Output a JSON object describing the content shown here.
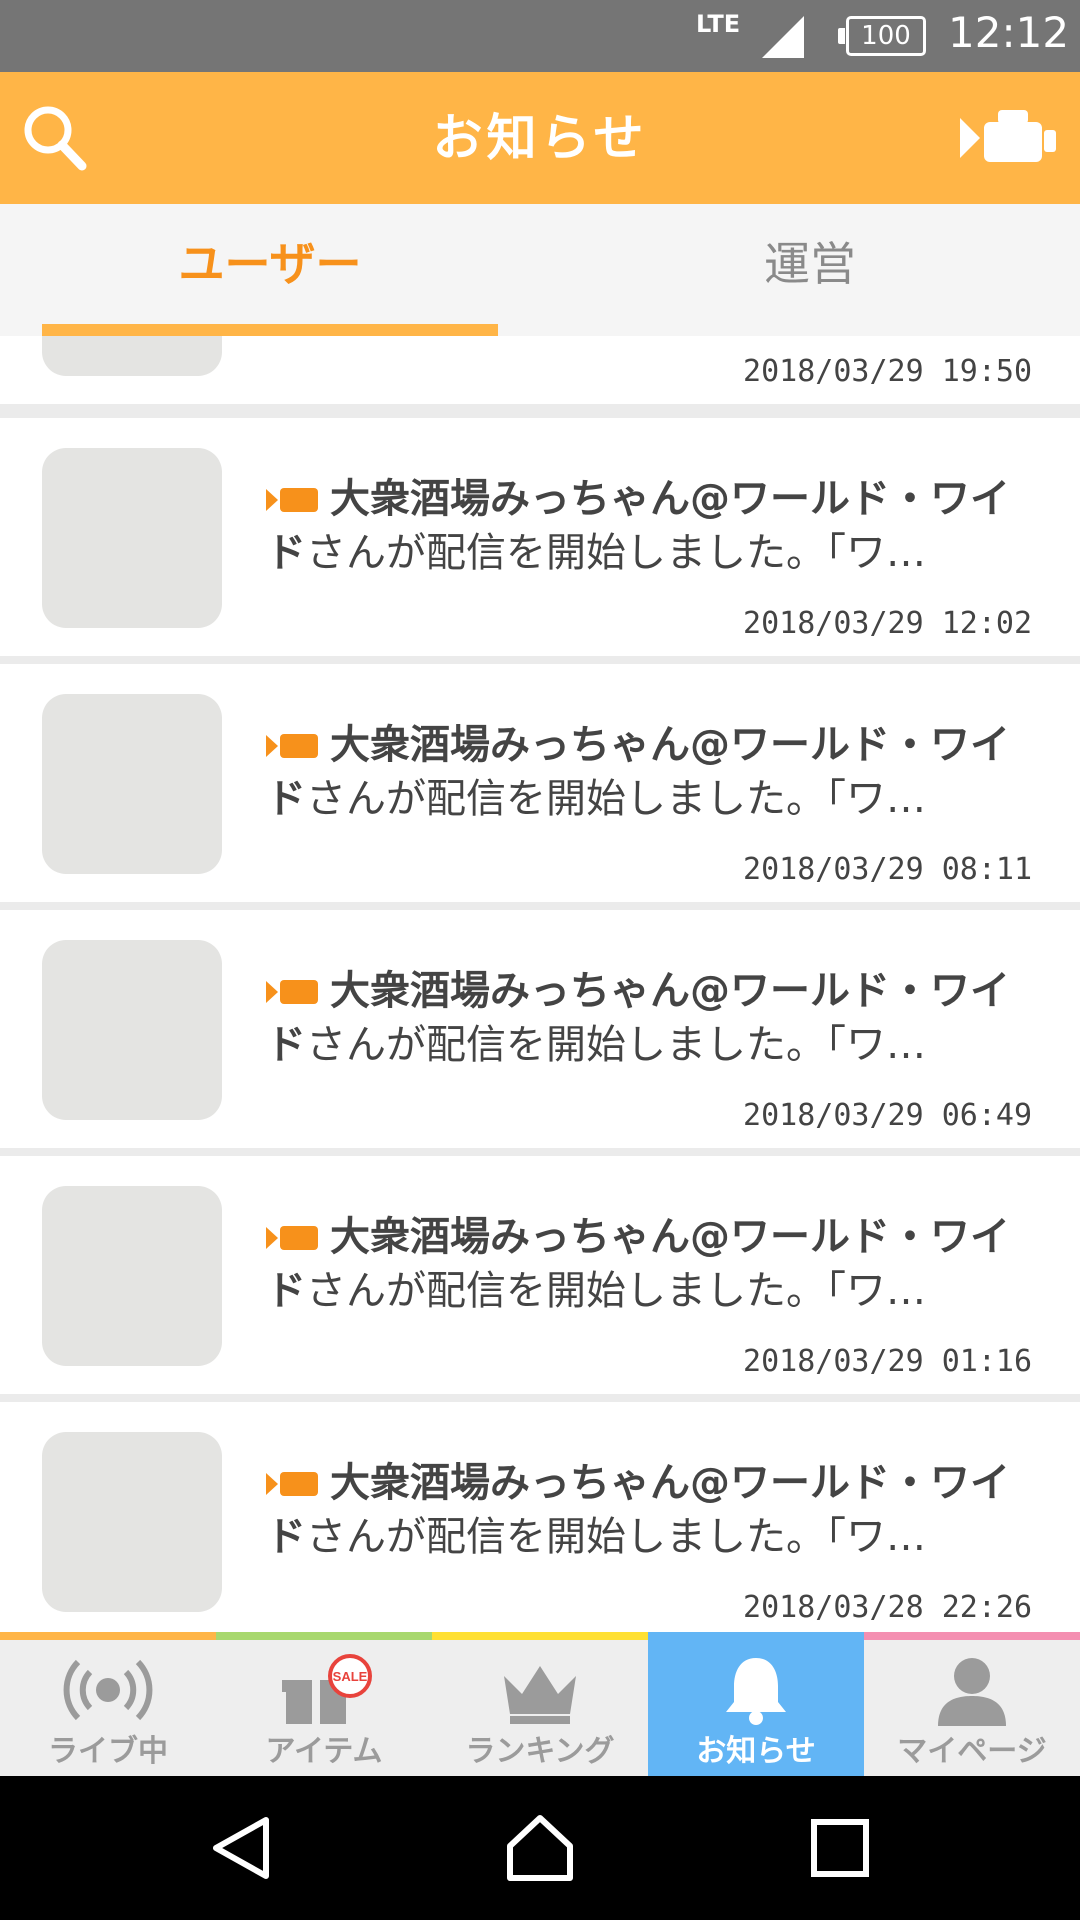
{
  "status_bar": {
    "network": "LTE",
    "battery": "100",
    "time": "12:12"
  },
  "header": {
    "title": "お知らせ",
    "search_icon": "search-icon",
    "broadcast_icon": "video-camera-icon"
  },
  "tabs": [
    {
      "label": "ユーザー",
      "active": true
    },
    {
      "label": "運営",
      "active": false
    }
  ],
  "notifications": [
    {
      "timestamp": "2018/03/29 19:50"
    },
    {
      "name": "大衆酒場みっちゃん@ワールド・ワイド",
      "text": "さんが配信を開始しました。「ワ…",
      "timestamp": "2018/03/29 12:02"
    },
    {
      "name": "大衆酒場みっちゃん@ワールド・ワイド",
      "text": "さんが配信を開始しました。「ワ…",
      "timestamp": "2018/03/29 08:11"
    },
    {
      "name": "大衆酒場みっちゃん@ワールド・ワイド",
      "text": "さんが配信を開始しました。「ワ…",
      "timestamp": "2018/03/29 06:49"
    },
    {
      "name": "大衆酒場みっちゃん@ワールド・ワイド",
      "text": "さんが配信を開始しました。「ワ…",
      "timestamp": "2018/03/29 01:16"
    },
    {
      "name": "大衆酒場みっちゃん@ワールド・ワイド",
      "text": "さんが配信を開始しました。「ワ…",
      "timestamp": "2018/03/28 22:26"
    }
  ],
  "bottom_nav": [
    {
      "label": "ライブ中",
      "icon": "broadcast-icon",
      "color": "#ffb547"
    },
    {
      "label": "アイテム",
      "icon": "gift-sale-icon",
      "badge": "SALE",
      "color": "#a8d86e"
    },
    {
      "label": "ランキング",
      "icon": "crown-icon",
      "color": "#ffe033"
    },
    {
      "label": "お知らせ",
      "icon": "bell-icon",
      "active": true,
      "color": "#62b5f5"
    },
    {
      "label": "マイページ",
      "icon": "person-icon",
      "color": "#f48fb1"
    }
  ],
  "colors": {
    "accent": "#ffb547",
    "active_tab_text": "#f7911b",
    "nav_active": "#62b5f5"
  }
}
